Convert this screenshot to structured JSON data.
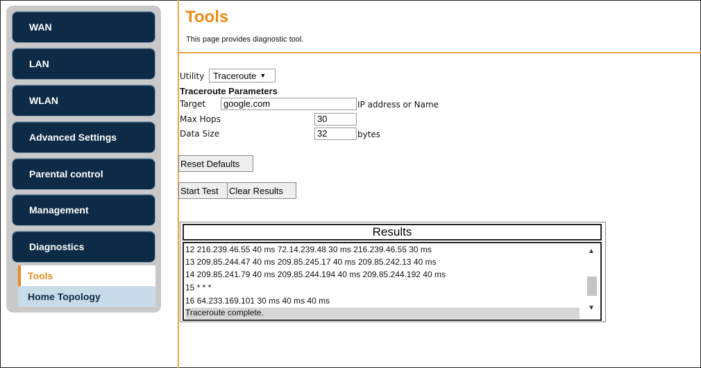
{
  "sidebar": {
    "items": [
      {
        "label": "WAN"
      },
      {
        "label": "LAN"
      },
      {
        "label": "WLAN"
      },
      {
        "label": "Advanced Settings"
      },
      {
        "label": "Parental control"
      },
      {
        "label": "Management"
      },
      {
        "label": "Diagnostics"
      }
    ],
    "sub_items": [
      {
        "label": "Tools",
        "active": true
      },
      {
        "label": "Home Topology",
        "active": false
      }
    ]
  },
  "page": {
    "title": "Tools",
    "description": "This page provides diagnostic tool."
  },
  "form": {
    "utility_label": "Utility",
    "utility_value": "Traceroute",
    "section_title": "Traceroute Parameters",
    "target_label": "Target",
    "target_value": "google.com",
    "target_hint": "IP address or Name",
    "max_hops_label": "Max Hops",
    "max_hops_value": "30",
    "data_size_label": "Data Size",
    "data_size_value": "32",
    "data_size_unit": "bytes",
    "reset_label": "Reset Defaults",
    "start_label": "Start Test",
    "clear_label": "Clear Results"
  },
  "results": {
    "header": "Results",
    "lines": [
      "12 216.239.46.55 40 ms 72.14.239.48 30 ms 216.239.46.55 30 ms",
      "13 209.85.244.47 40 ms 209.85.245.17 40 ms 209.85.242.13 40 ms",
      "14 209.85.241.79 40 ms 209.85.244.194 40 ms 209.85.244.192 40 ms",
      "15 * * *",
      "16 64.233.169.101 30 ms 40 ms 40 ms",
      "Traceroute complete."
    ]
  },
  "icons": {
    "scroll_up": "scroll-up-icon",
    "scroll_down": "scroll-down-icon",
    "dropdown": "dropdown-arrow-icon"
  },
  "colors": {
    "accent": "#f08a16",
    "nav_bg": "#0d2b46",
    "sub_nav_bg": "#c8dbe8"
  }
}
